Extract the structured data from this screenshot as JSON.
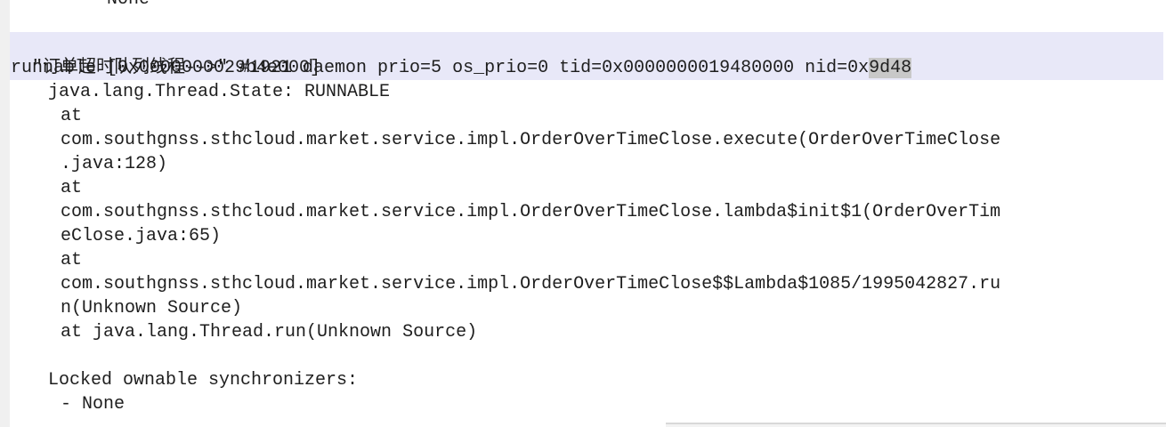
{
  "log": {
    "prev_tail": "- None",
    "header_prefix": "\"订单超时队列线程-->\" #1921 daemon prio=5 os_prio=0 tid=0x0000000019480000 nid=0x",
    "header_selected": "9d48",
    "header_line2": "runnable [0x0000000029b4e000]",
    "state": "java.lang.Thread.State: RUNNABLE",
    "frames": [
      "at",
      "com.southgnss.sthcloud.market.service.impl.OrderOverTimeClose.execute(OrderOverTimeClose",
      ".java:128)",
      "at",
      "com.southgnss.sthcloud.market.service.impl.OrderOverTimeClose.lambda$init$1(OrderOverTim",
      "eClose.java:65)",
      "at",
      "com.southgnss.sthcloud.market.service.impl.OrderOverTimeClose$$Lambda$1085/1995042827.ru",
      "n(Unknown Source)",
      "at java.lang.Thread.run(Unknown Source)"
    ],
    "locked_label": "Locked ownable synchronizers:",
    "locked_value": "- None"
  }
}
